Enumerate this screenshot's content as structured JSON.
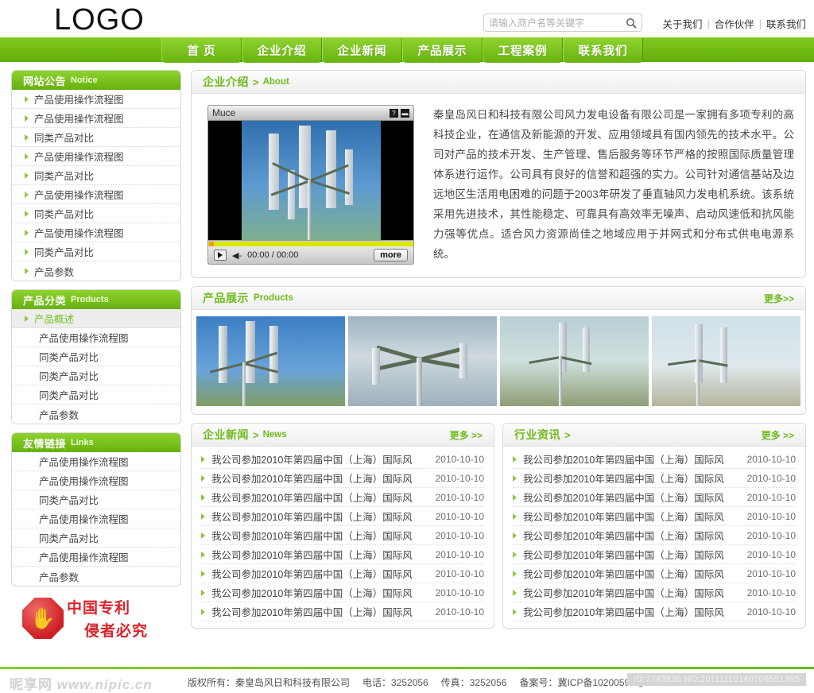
{
  "header": {
    "logo": "LOGO",
    "search": {
      "placeholder": "请输入商户名等关键字",
      "value": "",
      "icon": "search-icon"
    },
    "top_links": [
      {
        "label": "关于我们"
      },
      {
        "label": "合作伙伴"
      },
      {
        "label": "联系我们"
      }
    ],
    "separator": "|"
  },
  "nav": {
    "items": [
      {
        "label": "首 页"
      },
      {
        "label": "企业介绍"
      },
      {
        "label": "企业新闻"
      },
      {
        "label": "产品展示"
      },
      {
        "label": "工程案例"
      },
      {
        "label": "联系我们"
      }
    ]
  },
  "sidebar": {
    "notice": {
      "title_cn": "网站公告",
      "title_en": "Notice",
      "items": [
        {
          "label": "产品使用操作流程图"
        },
        {
          "label": "产品使用操作流程图"
        },
        {
          "label": "同类产品对比"
        },
        {
          "label": "产品使用操作流程图"
        },
        {
          "label": "同类产品对比"
        },
        {
          "label": "产品使用操作流程图"
        },
        {
          "label": "同类产品对比"
        },
        {
          "label": "产品使用操作流程图"
        },
        {
          "label": "同类产品对比"
        },
        {
          "label": "产品参数"
        }
      ]
    },
    "products": {
      "title_cn": "产品分类",
      "title_en": "Products",
      "items": [
        {
          "label": "产品概述",
          "active": true
        },
        {
          "label": "产品使用操作流程图",
          "active": false
        },
        {
          "label": "同类产品对比",
          "active": false
        },
        {
          "label": "同类产品对比",
          "active": false
        },
        {
          "label": "同类产品对比",
          "active": false
        },
        {
          "label": "产品参数",
          "active": false
        }
      ]
    },
    "links": {
      "title_cn": "友情链接",
      "title_en": "Links",
      "items": [
        {
          "label": "产品使用操作流程图"
        },
        {
          "label": "产品使用操作流程图"
        },
        {
          "label": "同类产品对比"
        },
        {
          "label": "产品使用操作流程图"
        },
        {
          "label": "同类产品对比"
        },
        {
          "label": "产品使用操作流程图"
        },
        {
          "label": "产品参数"
        }
      ]
    },
    "patent_badge": {
      "line1": "中国专利",
      "line2": "侵者必究",
      "icon": "stop-hand-icon"
    }
  },
  "about": {
    "title_cn": "企业介绍",
    "gt": ">",
    "title_en": "About",
    "player": {
      "name": "Muce",
      "help_button": "?",
      "minimize_button": "▬",
      "play_icon": "play-icon",
      "volume_icon": "◀-",
      "time": "00:00 / 00:00",
      "more_label": "more"
    },
    "text": "秦皇岛风日和科技有限公司风力发电设备有限公司是一家拥有多项专利的高科技企业，在通信及新能源的开发、应用领域具有国内领先的技术水平。公司对产品的技术开发、生产管理、售后服务等环节严格的按照国际质量管理体系进行运作。公司具有良好的信誉和超强的实力。公司针对通信基站及边远地区生活用电困难的问题于2003年研发了垂直轴风力发电机系统。该系统采用先进技术，其性能稳定、可靠具有高效率无噪声、启动风速低和抗风能力强等优点。适合风力资源尚佳之地域应用于并网式和分布式供电电源系统。"
  },
  "products_showcase": {
    "title_cn": "产品展示",
    "title_en": "Products",
    "more_label": "更多>>",
    "images": [
      {
        "alt": "垂直轴风力发电机 蓝天"
      },
      {
        "alt": "垂直轴风力发电机 云层"
      },
      {
        "alt": "垂直轴风力发电机 山地"
      },
      {
        "alt": "垂直轴风力发电机 厂区"
      }
    ]
  },
  "company_news": {
    "title_cn": "企业新闻",
    "gt": ">",
    "title_en": "News",
    "more_label": "更多 >>",
    "items": [
      {
        "title": "我公司参加2010年第四届中国（上海）国际风",
        "date": "2010-10-10"
      },
      {
        "title": "我公司参加2010年第四届中国（上海）国际风",
        "date": "2010-10-10"
      },
      {
        "title": "我公司参加2010年第四届中国（上海）国际风",
        "date": "2010-10-10"
      },
      {
        "title": "我公司参加2010年第四届中国（上海）国际风",
        "date": "2010-10-10"
      },
      {
        "title": "我公司参加2010年第四届中国（上海）国际风",
        "date": "2010-10-10"
      },
      {
        "title": "我公司参加2010年第四届中国（上海）国际风",
        "date": "2010-10-10"
      },
      {
        "title": "我公司参加2010年第四届中国（上海）国际风",
        "date": "2010-10-10"
      },
      {
        "title": "我公司参加2010年第四届中国（上海）国际风",
        "date": "2010-10-10"
      },
      {
        "title": "我公司参加2010年第四届中国（上海）国际风",
        "date": "2010-10-10"
      }
    ]
  },
  "industry_news": {
    "title_cn": "行业资讯",
    "gt": ">",
    "title_en": "",
    "more_label": "更多 >>",
    "items": [
      {
        "title": "我公司参加2010年第四届中国（上海）国际风",
        "date": "2010-10-10"
      },
      {
        "title": "我公司参加2010年第四届中国（上海）国际风",
        "date": "2010-10-10"
      },
      {
        "title": "我公司参加2010年第四届中国（上海）国际风",
        "date": "2010-10-10"
      },
      {
        "title": "我公司参加2010年第四届中国（上海）国际风",
        "date": "2010-10-10"
      },
      {
        "title": "我公司参加2010年第四届中国（上海）国际风",
        "date": "2010-10-10"
      },
      {
        "title": "我公司参加2010年第四届中国（上海）国际风",
        "date": "2010-10-10"
      },
      {
        "title": "我公司参加2010年第四届中国（上海）国际风",
        "date": "2010-10-10"
      },
      {
        "title": "我公司参加2010年第四届中国（上海）国际风",
        "date": "2010-10-10"
      },
      {
        "title": "我公司参加2010年第四届中国（上海）国际风",
        "date": "2010-10-10"
      }
    ]
  },
  "footer": {
    "watermark_cn": "昵享网",
    "watermark_url": "www.nipic.cn",
    "copyright": "版权所有：秦皇岛风日和科技有限公司",
    "phone": "电话：3252056",
    "fax": "传真：3252056",
    "icp": "备案号：冀ICP备10200595号",
    "id_badge": "ID:7743836 NO:20111110140709551365"
  },
  "colors": {
    "brand_green": "#7ec820",
    "nav_green": "#8ed32f",
    "accent_text": "#6fbb1c",
    "patent_red": "#d8232a",
    "progress_yellow": "#dbe600"
  }
}
